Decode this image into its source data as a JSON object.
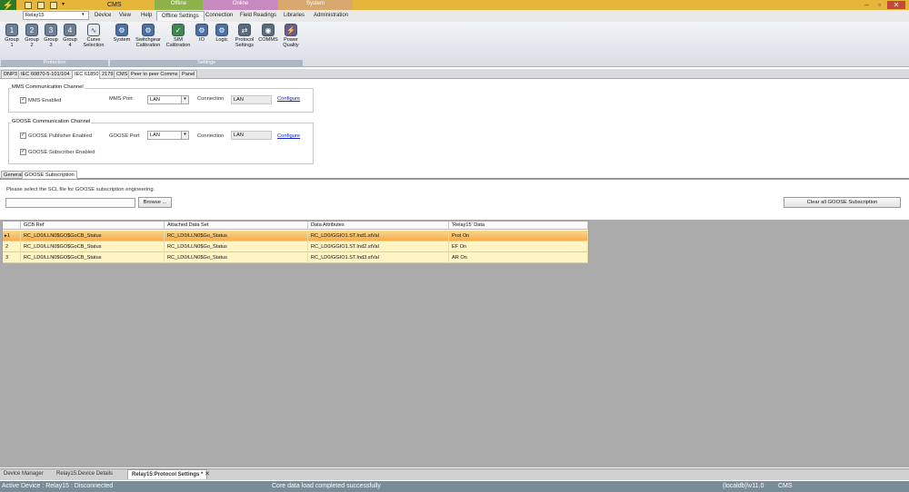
{
  "app": {
    "title": "CMS",
    "context_tabs": [
      {
        "label": "Offline",
        "color": "#8db24a"
      },
      {
        "label": "Online",
        "color": "#c78ac0"
      },
      {
        "label": "System",
        "color": "#d8a86f"
      }
    ],
    "accent": "#e6b63a"
  },
  "device_selector": {
    "value": "Relay15"
  },
  "menu": [
    "Device",
    "View",
    "Help",
    "Offline Settings",
    "Connection",
    "Field Readings",
    "Libraries",
    "Administration"
  ],
  "menu_active": "Offline Settings",
  "ribbon": {
    "protection": {
      "label": "Protection",
      "buttons": [
        {
          "line1": "Group",
          "line2": "1",
          "icon": "group-1-icon"
        },
        {
          "line1": "Group",
          "line2": "2",
          "icon": "group-2-icon"
        },
        {
          "line1": "Group",
          "line2": "3",
          "icon": "group-3-icon"
        },
        {
          "line1": "Group",
          "line2": "4",
          "icon": "group-4-icon"
        },
        {
          "line1": "Curve",
          "line2": "Selection",
          "icon": "curve-icon"
        }
      ]
    },
    "settings": {
      "label": "Settings",
      "buttons": [
        {
          "line1": "System",
          "line2": "",
          "icon": "system-icon"
        },
        {
          "line1": "Switchgear",
          "line2": "Calibration",
          "icon": "switchgear-icon"
        },
        {
          "line1": "SIM",
          "line2": "Calibration",
          "icon": "sim-icon"
        },
        {
          "line1": "IO",
          "line2": "",
          "icon": "io-icon"
        },
        {
          "line1": "Logic",
          "line2": "",
          "icon": "logic-icon"
        },
        {
          "line1": "Protocol",
          "line2": "Settings",
          "icon": "protocol-icon"
        },
        {
          "line1": "COMMS",
          "line2": "",
          "icon": "comms-icon"
        },
        {
          "line1": "Power",
          "line2": "Quality",
          "icon": "power-icon"
        }
      ]
    }
  },
  "protocol_tabs": [
    "DNP3",
    "IEC 60870-5-101/104",
    "IEC 61850",
    "2179",
    "CMS",
    "Peer to peer Comms",
    "Panel"
  ],
  "protocol_tab_active": "IEC 61850",
  "mms": {
    "title": "MMS Communication Channel",
    "enabled_label": "MMS Enabled",
    "port_label": "MMS Port",
    "port_value": "LAN",
    "connection_label": "Connection",
    "connection_value": "LAN",
    "configure": "Configure"
  },
  "goose": {
    "title": "GOOSE Communication Channel",
    "publisher_label": "GOOSE Publisher Enabled",
    "subscriber_label": "GOOSE Subscriber Enabled",
    "port_label": "GOOSE Port",
    "port_value": "LAN",
    "connection_label": "Connection",
    "connection_value": "LAN",
    "configure": "Configure"
  },
  "sub_tabs": [
    "General",
    "GOOSE Subscription"
  ],
  "sub_tab_active": "GOOSE Subscription",
  "subscription": {
    "instruction": "Please select the SCL file for GOOSE subscription engineering.",
    "browse": "Browse ...",
    "clear_all": "Clear all GOOSE Subscription"
  },
  "grid": {
    "columns": [
      "GCB Ref",
      "Attached Data Set",
      "Data Attributes",
      "'Relay15' Data"
    ],
    "rows": [
      {
        "num": "1",
        "gcb": "RC_LD0/LLN0$GO$GoCB_Status",
        "dataset": "RC_LD0/LLN0$Go_Status",
        "attr": "RC_LD0/GGIO1.ST.Ind1.stVal",
        "data": "Prot On"
      },
      {
        "num": "2",
        "gcb": "RC_LD0/LLN0$GO$GoCB_Status",
        "dataset": "RC_LD0/LLN0$Go_Status",
        "attr": "RC_LD0/GGIO1.ST.Ind2.stVal",
        "data": "EF On"
      },
      {
        "num": "3",
        "gcb": "RC_LD0/LLN0$GO$GoCB_Status",
        "dataset": "RC_LD0/LLN0$Go_Status",
        "attr": "RC_LD0/GGIO1.ST.Ind3.stVal",
        "data": "AR On"
      }
    ]
  },
  "doc_tabs": [
    "Device Manager",
    "Relay15:Device Details",
    "Relay15:Protocol Settings *"
  ],
  "doc_tab_active": "Relay15:Protocol Settings *",
  "status": {
    "left": "Active Device : Relay15 : Disconnected",
    "center": "Core data load completed successfully",
    "db": "(localdb)\\v11.0",
    "app": "CMS"
  }
}
